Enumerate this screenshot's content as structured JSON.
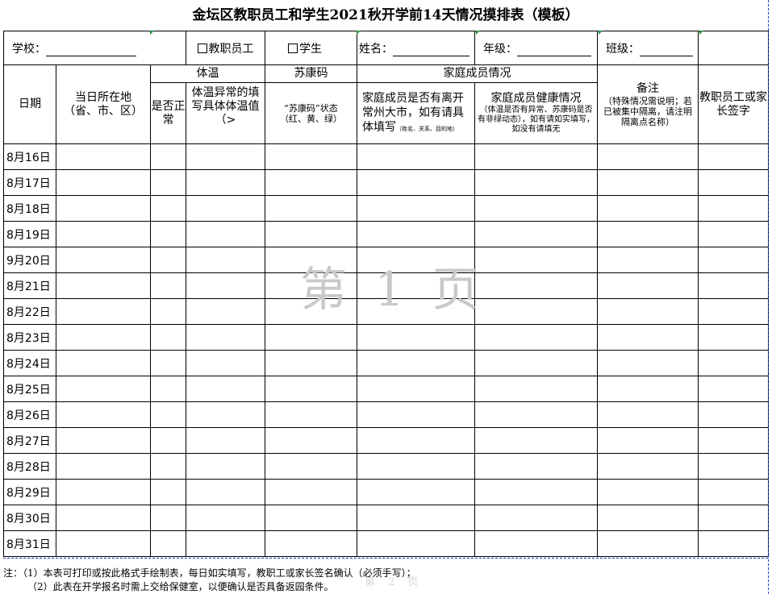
{
  "title": "金坛区教职员工和学生2021秋开学前14天情况摸排表（模板）",
  "info": {
    "school_label": "学校：",
    "staff_label": "教职员工",
    "student_label": "学生",
    "name_label": "姓名：",
    "grade_label": "年级：",
    "class_label": "班级："
  },
  "header": {
    "date": "日期",
    "location": "当日所在地（省、市、区）",
    "temperature": "体温",
    "temp_normal": "是否正常",
    "temp_abnormal": "体温异常的填写具体体温值（>",
    "sukang": "苏康码",
    "sukang_status": "“苏康码”状态",
    "sukang_colors": "（红、黄、绿）",
    "family": "家庭成员情况",
    "family_leave_main": "家庭成员是否有离开常州大市，如有请具体填写",
    "family_leave_note": "（姓名、关系、目的地）",
    "family_health_main": "家庭成员健康情况",
    "family_health_note": "（体温是否有异常、苏康码是否有非绿动态），如有请如实填写，如没有请填无",
    "remark": "备注",
    "remark_note": "（特殊情况需说明；若已被集中隔离，请注明隔离点名称）",
    "sign": "教职员工或家长签字"
  },
  "dates": [
    "8月16日",
    "8月17日",
    "8月18日",
    "8月19日",
    "9月20日",
    "8月21日",
    "8月22日",
    "8月23日",
    "8月24日",
    "8月25日",
    "8月26日",
    "8月27日",
    "8月28日",
    "8月29日",
    "8月30日",
    "8月31日"
  ],
  "watermark": "第 1 页",
  "watermark2": "第 2 页",
  "notes": [
    "注：（1）本表可打印或按此格式手绘制表，每日如实填写，教职工或家长签名确认（必须手写）；",
    "（2）此表在开学报名时需上交给保健室，以便确认是否具备返园条件。"
  ],
  "colors": {
    "page_break": "#1f3fbf",
    "marker": "#1c8f3a",
    "watermark": "#c9c9c9"
  }
}
